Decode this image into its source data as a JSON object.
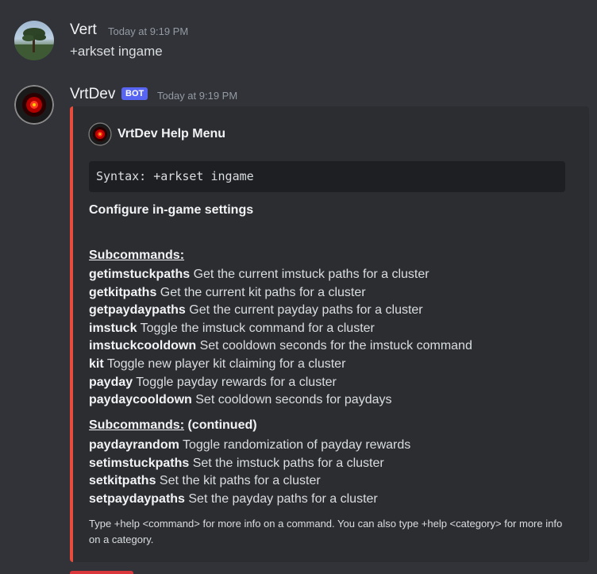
{
  "message1": {
    "author": "Vert",
    "timestamp": "Today at 9:19 PM",
    "content": "+arkset ingame"
  },
  "message2": {
    "author": "VrtDev",
    "bot_tag": "BOT",
    "timestamp": "Today at 9:19 PM",
    "embed": {
      "accent_color": "#e74c3c",
      "title": "VrtDev Help Menu",
      "syntax": "Syntax: +arkset ingame",
      "description": "Configure in-game settings",
      "section1_heading": "Subcommands:",
      "section1": [
        {
          "command": "getimstuckpaths",
          "desc": "Get the current imstuck paths for a cluster"
        },
        {
          "command": "getkitpaths",
          "desc": "Get the current kit paths for a cluster"
        },
        {
          "command": "getpaydaypaths",
          "desc": "Get the current payday paths for a cluster"
        },
        {
          "command": "imstuck",
          "desc": "Toggle the imstuck command for a cluster"
        },
        {
          "command": "imstuckcooldown",
          "desc": "Set cooldown seconds for the imstuck command"
        },
        {
          "command": "kit",
          "desc": "Toggle new player kit claiming for a cluster"
        },
        {
          "command": "payday",
          "desc": "Toggle payday rewards for a cluster"
        },
        {
          "command": "paydaycooldown",
          "desc": "Set cooldown seconds for paydays"
        }
      ],
      "section2_heading": "Subcommands:",
      "section2_suffix": "(continued)",
      "section2": [
        {
          "command": "paydayrandom",
          "desc": "Toggle randomization of payday rewards"
        },
        {
          "command": "setimstuckpaths",
          "desc": "Set the imstuck paths for a cluster"
        },
        {
          "command": "setkitpaths",
          "desc": "Set the kit paths for a cluster"
        },
        {
          "command": "setpaydaypaths",
          "desc": "Set the payday paths for a cluster"
        }
      ],
      "footer": "Type +help <command> for more info on a command. You can also type +help <category> for more info on a category."
    }
  },
  "colors": {
    "background": "#313338",
    "embed_bg": "#2b2d31",
    "bot_tag": "#5865f2"
  }
}
